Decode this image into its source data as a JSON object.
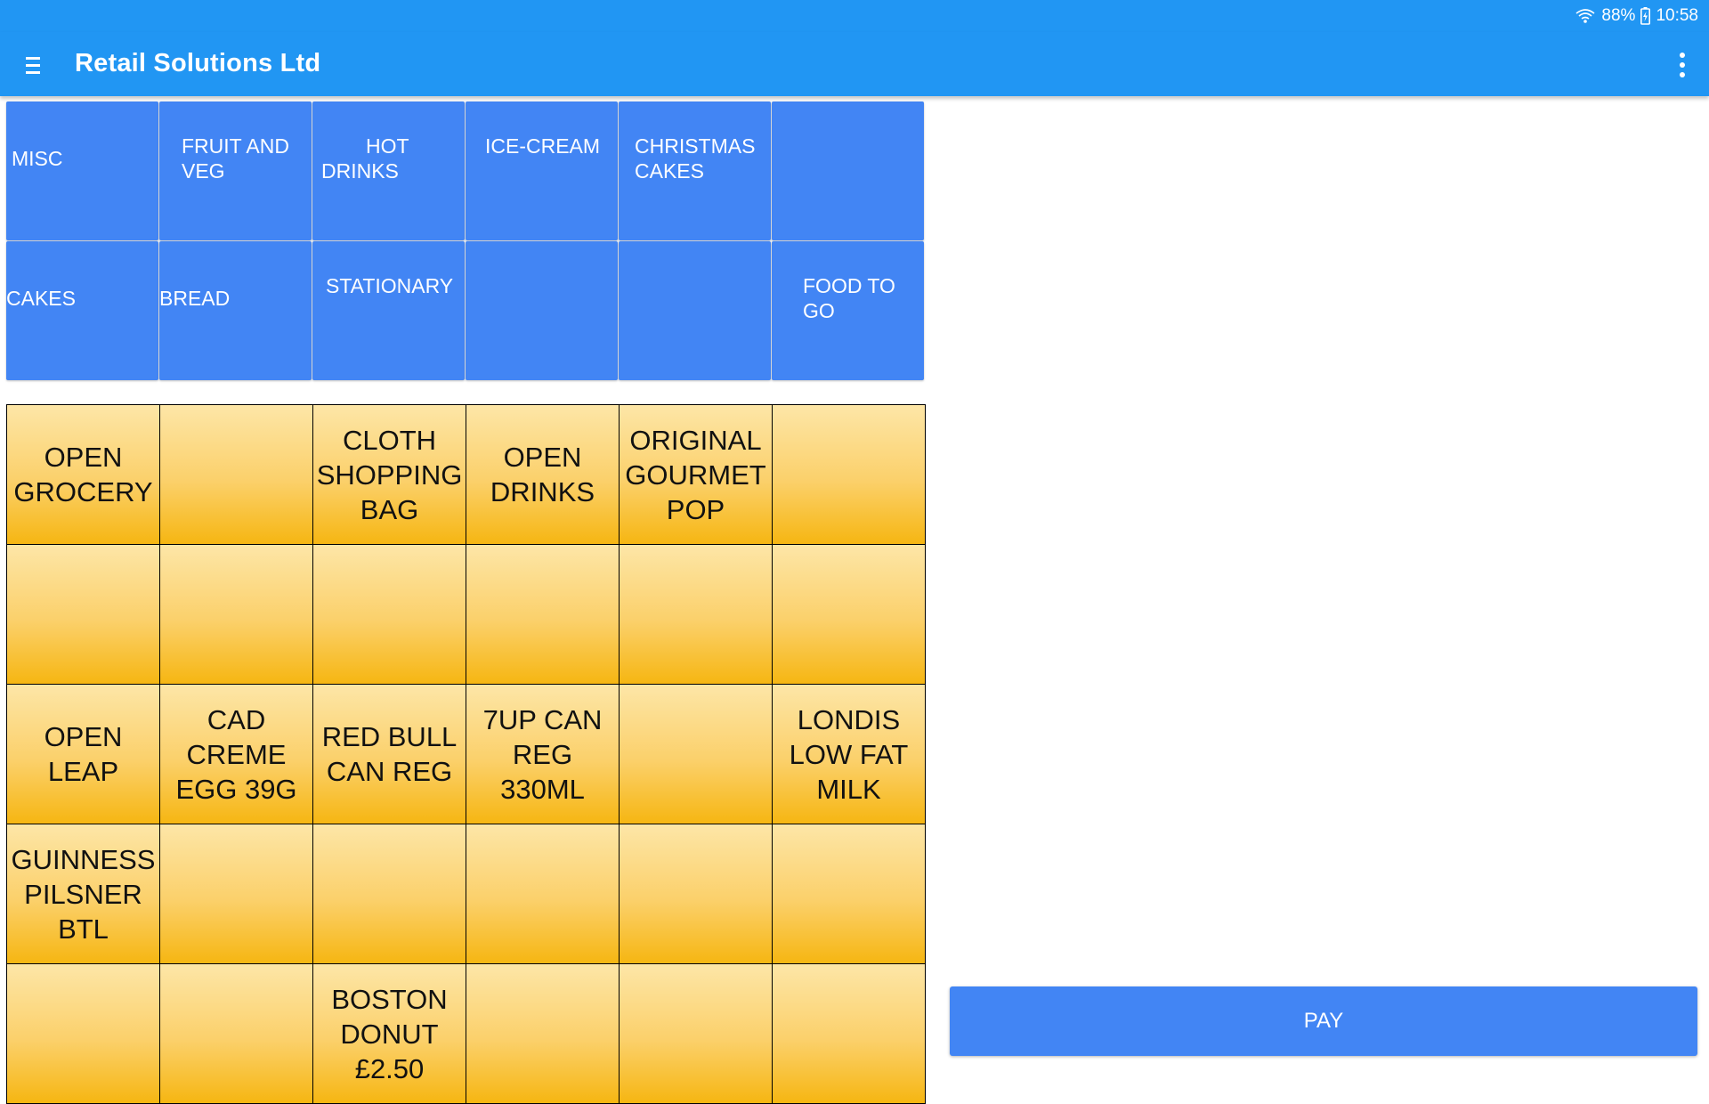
{
  "status_bar": {
    "battery": "88%",
    "time": "10:58",
    "icons": [
      "wifi-icon",
      "battery-charging-icon"
    ]
  },
  "app_bar": {
    "title": "Retail Solutions Ltd",
    "menu_icon": "hamburger-menu-icon",
    "overflow_icon": "more-vert-icon"
  },
  "categories": [
    {
      "label": "MISC"
    },
    {
      "label": "FRUIT AND\nVEG"
    },
    {
      "label": "HOT\nDRINKS"
    },
    {
      "label": "ICE-CREAM"
    },
    {
      "label": "CHRISTMAS\nCAKES"
    },
    {
      "label": ""
    },
    {
      "label": "CAKES"
    },
    {
      "label": "BREAD"
    },
    {
      "label": "STATIONARY"
    },
    {
      "label": ""
    },
    {
      "label": ""
    },
    {
      "label": "FOOD TO\nGO"
    }
  ],
  "products": [
    {
      "label": "OPEN GROCERY"
    },
    {
      "label": ""
    },
    {
      "label": "CLOTH SHOPPING BAG"
    },
    {
      "label": "OPEN DRINKS"
    },
    {
      "label": "ORIGINAL GOURMET POP"
    },
    {
      "label": ""
    },
    {
      "label": ""
    },
    {
      "label": ""
    },
    {
      "label": ""
    },
    {
      "label": ""
    },
    {
      "label": ""
    },
    {
      "label": ""
    },
    {
      "label": "OPEN LEAP"
    },
    {
      "label": "CAD CREME EGG 39G"
    },
    {
      "label": "RED BULL CAN REG"
    },
    {
      "label": "7UP CAN REG 330ML"
    },
    {
      "label": ""
    },
    {
      "label": "LONDIS LOW FAT MILK"
    },
    {
      "label": "GUINNESS PILSNER BTL"
    },
    {
      "label": ""
    },
    {
      "label": ""
    },
    {
      "label": ""
    },
    {
      "label": ""
    },
    {
      "label": ""
    },
    {
      "label": ""
    },
    {
      "label": ""
    },
    {
      "label": "BOSTON DONUT £2.50"
    },
    {
      "label": ""
    },
    {
      "label": ""
    },
    {
      "label": ""
    }
  ],
  "pay_button": {
    "label": "PAY"
  },
  "colors": {
    "app_bar": "#2196f3",
    "category_button": "#4285f4",
    "product_button_top": "#fde6a7",
    "product_button_bottom": "#f6b612",
    "pay_button": "#4285f4"
  }
}
